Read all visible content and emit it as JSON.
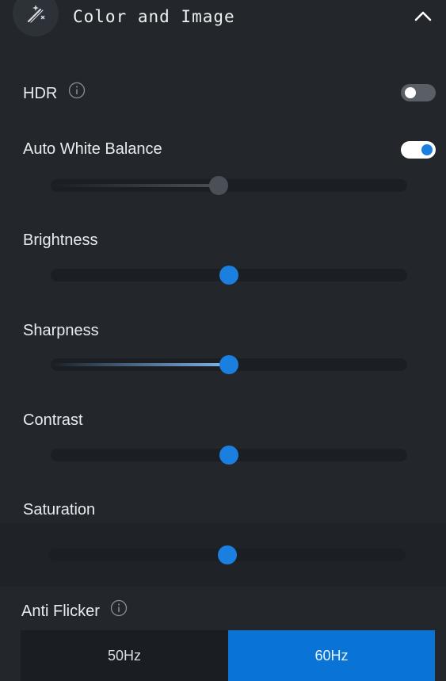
{
  "header": {
    "title": "Color and Image",
    "icon": "magic-wand-icon",
    "collapse_icon": "chevron-up-icon"
  },
  "hdr": {
    "label": "HDR",
    "enabled": false
  },
  "awb": {
    "label": "Auto White Balance",
    "enabled": true,
    "slider_value": 0.47,
    "slider_disabled": true
  },
  "brightness": {
    "label": "Brightness",
    "value": 0.5
  },
  "sharpness": {
    "label": "Sharpness",
    "value": 0.5
  },
  "contrast": {
    "label": "Contrast",
    "value": 0.5
  },
  "saturation": {
    "label": "Saturation",
    "value": 0.5
  },
  "anti_flicker": {
    "label": "Anti Flicker",
    "options": [
      "50Hz",
      "60Hz"
    ],
    "selected": "60Hz"
  },
  "colors": {
    "background": "#23272c",
    "accent": "#0a74d6",
    "thumb": "#1b7fe0"
  }
}
